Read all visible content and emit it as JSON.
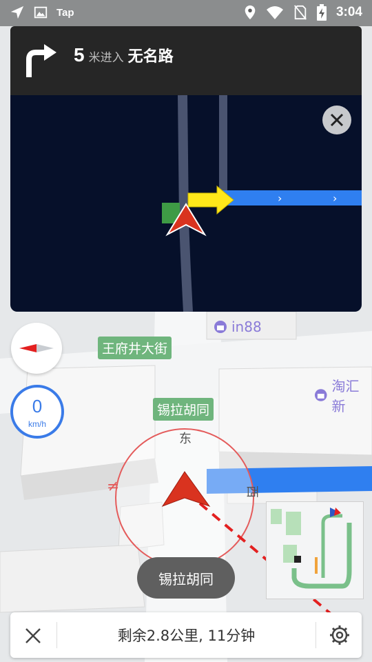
{
  "status_bar": {
    "app_label": "Tap",
    "time": "3:04",
    "icons": [
      "navigation-arrow-icon",
      "image-icon",
      "location-pin-icon",
      "wifi-icon",
      "no-sim-icon",
      "battery-charging-icon"
    ]
  },
  "nav": {
    "distance": "5",
    "unit_action": "米进入",
    "road_name": "无名路",
    "turn": "turn-right-icon"
  },
  "map": {
    "poi_in88": "in88",
    "poi_taohui": "淘汇新",
    "street_wangfujing": "王府井大街",
    "street_xilahutong": "锡拉胡同",
    "dir_east": "东",
    "dir_west": "西"
  },
  "speed": {
    "value": "0",
    "unit": "km/h"
  },
  "toast": {
    "road": "锡拉胡同"
  },
  "bottom": {
    "summary": "剩余2.8公里, 11分钟"
  },
  "colors": {
    "route_blue": "#2f7ff0",
    "accent_red": "#e32020",
    "speed_blue": "#3a7be8",
    "tag_green": "#6fb57d"
  }
}
